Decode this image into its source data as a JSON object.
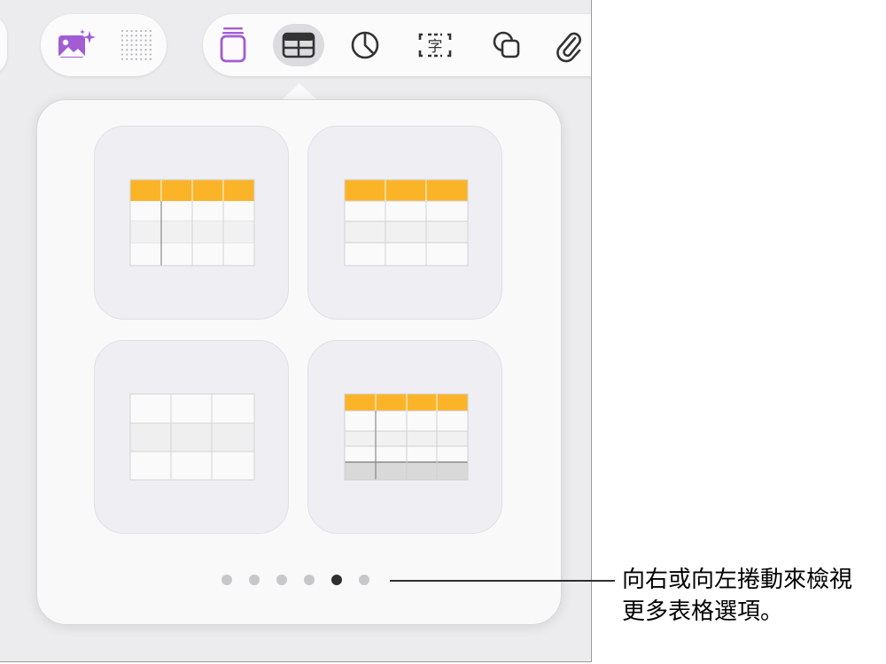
{
  "toolbar": {
    "left_group": [
      {
        "icon": "photo-sparkle-icon"
      },
      {
        "icon": "dot-grid-icon"
      }
    ],
    "insert_group": [
      {
        "icon": "text-box-icon",
        "selected": false
      },
      {
        "icon": "table-icon",
        "selected": true
      },
      {
        "icon": "chart-icon",
        "selected": false
      },
      {
        "icon": "text-field-icon",
        "glyph": "字",
        "selected": false
      },
      {
        "icon": "shapes-icon",
        "selected": false
      },
      {
        "icon": "paperclip-icon",
        "selected": false
      }
    ],
    "colors": {
      "accent": "#a15cd6",
      "icon": "#333333"
    }
  },
  "table_styles": {
    "header_color": "#fbb328",
    "options": [
      {
        "name": "header-row-and-column",
        "header_row": true,
        "header_column": true,
        "footer": false
      },
      {
        "name": "header-row",
        "header_row": true,
        "header_column": false,
        "footer": false
      },
      {
        "name": "plain",
        "header_row": false,
        "header_column": false,
        "footer": false
      },
      {
        "name": "header-row-column-footer",
        "header_row": true,
        "header_column": true,
        "footer": true
      }
    ]
  },
  "pagination": {
    "count": 6,
    "active_index": 4
  },
  "callout": {
    "line1": "向右或向左捲動來檢視",
    "line2": "更多表格選項。"
  }
}
